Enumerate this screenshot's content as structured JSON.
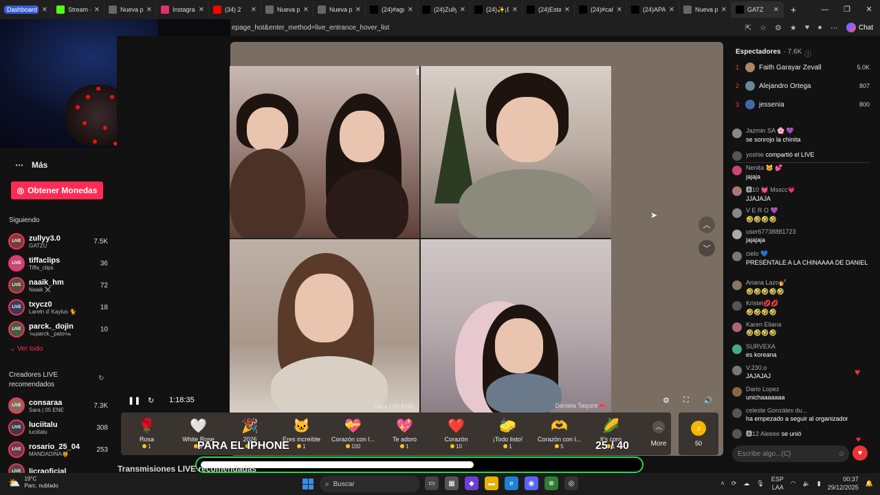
{
  "browser": {
    "tabs": [
      {
        "label": "Dashboard",
        "icon": "dashboard-icon",
        "color": "#3a5bd6"
      },
      {
        "label": "Stream - K",
        "icon": "k-icon",
        "color": "#53fc18"
      },
      {
        "label": "Nueva pe",
        "icon": "page-icon",
        "color": "#666"
      },
      {
        "label": "Instagram",
        "icon": "instagram-icon",
        "color": "#e1306c"
      },
      {
        "label": "(34) 2",
        "icon": "youtube-icon",
        "color": "#ff0000"
      },
      {
        "label": "Nueva pe",
        "icon": "page-icon",
        "color": "#666"
      },
      {
        "label": "Nueva pe",
        "icon": "page-icon",
        "color": "#666"
      },
      {
        "label": "(24)#agus",
        "icon": "tiktok-icon",
        "color": "#000"
      },
      {
        "label": "(24)Zully",
        "icon": "tiktok-icon",
        "color": "#000"
      },
      {
        "label": "(24)✨¡Bi",
        "icon": "tiktok-icon",
        "color": "#000"
      },
      {
        "label": "(24)Esta c",
        "icon": "tiktok-icon",
        "color": "#000"
      },
      {
        "label": "(24)#cañi",
        "icon": "tiktok-icon",
        "color": "#000"
      },
      {
        "label": "(24)APAR",
        "icon": "tiktok-icon",
        "color": "#000"
      },
      {
        "label": "Nueva pe",
        "icon": "page-icon",
        "color": "#666"
      },
      {
        "label": "GATZ",
        "icon": "tiktok-icon",
        "color": "#000"
      }
    ],
    "new_tab": "+",
    "url": "epage_hot&enter_method=live_entrance_hover_list",
    "chat_label": "Chat"
  },
  "sidebar": {
    "more_label": "Más",
    "coins_button": "Obtener Monedas",
    "following_title": "Siguiendo",
    "following": [
      {
        "name": "zullyy3.0",
        "sub": "GATZU",
        "count": "7.5K",
        "color": "#7a3b3b"
      },
      {
        "name": "tiffaclips",
        "sub": "Tiffa_clips",
        "count": "36",
        "color": "#c04a7a"
      },
      {
        "name": "naaik_hm",
        "sub": "Naaik ⚔️",
        "count": "72",
        "color": "#5a4b3b"
      },
      {
        "name": "txycz0",
        "sub": "Lareln d' Kaylus·🐈",
        "count": "18",
        "color": "#3b3b5a"
      },
      {
        "name": "parck._dojin",
        "sub": "🐜parck._pato🐜",
        "count": "10",
        "color": "#4a5a3b"
      }
    ],
    "see_all": "Ver todo",
    "recommended_title": "Creadores LIVE recomendados",
    "recommended": [
      {
        "name": "consaraa",
        "sub": "Sara | 05 ENE",
        "count": "7.3K",
        "color": "#8a6a5a"
      },
      {
        "name": "luciitalu",
        "sub": "luciitalu",
        "count": "308",
        "color": "#3b3b4a"
      },
      {
        "name": "rosario_25_04",
        "sub": "MANDADINA🍯",
        "count": "253",
        "color": "#6a3b4a"
      },
      {
        "name": "licraoficial",
        "sub": "",
        "count": "",
        "color": "#4a4a4a"
      }
    ]
  },
  "player": {
    "time": "1:18:35",
    "cell_labels": [
      "",
      "",
      "Sara | 05 ENE",
      "Daniela Taquire🎀"
    ],
    "overlay_text": "PARA EL IPHONE",
    "counter": "25 / 40",
    "progress": 0.62,
    "bottom_title": "Transmisiones LIVE recomendadas"
  },
  "gifts": [
    {
      "name": "Rosa",
      "price": "1",
      "emoji": "🌹"
    },
    {
      "name": "White Rose",
      "price": "1",
      "emoji": "🤍"
    },
    {
      "name": "2026",
      "price": "1",
      "emoji": "🎉"
    },
    {
      "name": "Eres increíble",
      "price": "1",
      "emoji": "🐱"
    },
    {
      "name": "Corazón con l...",
      "price": "100",
      "emoji": "💝"
    },
    {
      "name": "Te adoro",
      "price": "1",
      "emoji": "💖"
    },
    {
      "name": "Corazón",
      "price": "10",
      "emoji": "❤️"
    },
    {
      "name": "¡Todo listo!",
      "price": "1",
      "emoji": "🧽"
    },
    {
      "name": "Corazón con l...",
      "price": "5",
      "emoji": "🫶"
    },
    {
      "name": "It's corn",
      "price": "1",
      "emoji": "🌽"
    }
  ],
  "gift_more": "More",
  "gift_coins": "50",
  "viewers": {
    "title": "Espectadores",
    "count": "· 7.6K",
    "top": [
      {
        "rank": "1",
        "name": "Faith Garayar Zevall",
        "value": "5.0K",
        "color": "#aa8866"
      },
      {
        "rank": "2",
        "name": "Alejandro Ortega",
        "value": "807",
        "color": "#668899"
      },
      {
        "rank": "3",
        "name": "jessenia",
        "value": "800",
        "color": "#4466aa"
      }
    ]
  },
  "chat": [
    {
      "user": "Jazmin SA 🌸 💜",
      "text": "se sonrojo la chinita",
      "color": "#888"
    },
    {
      "user": "yoshie",
      "text": "compartió el LIVE",
      "inline": true,
      "color": "#555"
    },
    {
      "user": "Nenita 🐱 💕",
      "text": "jajaja",
      "color": "#c47"
    },
    {
      "user": "🅰10 💓 Msscc💗",
      "text": "JJAJAJA",
      "color": "#a77"
    },
    {
      "user": "V E R O 💜",
      "text": "🤣🤣🤣🤣",
      "color": "#888"
    },
    {
      "user": "user67738881723",
      "text": "jajajaja",
      "color": "#aaa"
    },
    {
      "user": "cielo 💙",
      "text": "PRESÉNTALE A LA CHINAAAA DE DANIEL",
      "color": "#777"
    },
    {
      "user": "Ariana Lazo💅",
      "text": "🤣🤣🤣🤣🤣",
      "color": "#876"
    },
    {
      "user": "Kristel💋💋",
      "text": "🤣🤣🤣🤣",
      "color": "#555"
    },
    {
      "user": "Karen Eliana",
      "text": "🤣🤣🤣🤣",
      "color": "#a67"
    },
    {
      "user": "SURVEXA",
      "text": "es koreana",
      "color": "#4a8"
    },
    {
      "user": "V.230.o",
      "text": "JAJAJAJ",
      "color": "#777"
    },
    {
      "user": "Dario Lopez",
      "text": "unichaaaaaaa",
      "color": "#864"
    },
    {
      "user": "celeste Gonzáles du...",
      "text": "ha empezado a seguir al organizador",
      "color": "#555"
    },
    {
      "user": "🅰12 Aleeee",
      "text": "se unió",
      "inline": true,
      "color": "#555"
    }
  ],
  "chat_input_placeholder": "Escribe algo...(C)",
  "taskbar": {
    "temp": "19°C",
    "weather": "Parc. nublado",
    "search": "Buscar",
    "lang1": "ESP",
    "lang2": "LAA",
    "time": "00:37",
    "date": "29/12/2025"
  }
}
